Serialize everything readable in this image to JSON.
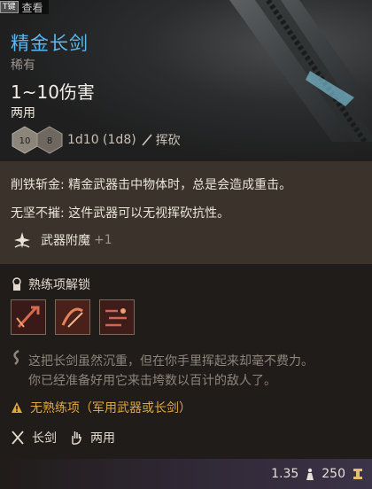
{
  "hint": {
    "key": "T键",
    "label": "查看"
  },
  "item": {
    "name": "精金长剑",
    "rarity": "稀有",
    "damage": "1~10伤害",
    "handedness": "两用",
    "dice": {
      "first": "10",
      "second": "8"
    },
    "dice_text": "1d10 (1d8)",
    "damage_type": "挥砍"
  },
  "properties": {
    "line1": "削铁斩金: 精金武器击中物体时，总是会造成重击。",
    "line2": "无坚不摧: 这件武器可以无视挥砍抗性。",
    "enchant_label": "武器附魔",
    "enchant_value": "+1"
  },
  "proficiency": {
    "label": "熟练项解锁",
    "skills": [
      "skill-1",
      "skill-2",
      "skill-3"
    ]
  },
  "flavor": {
    "line1": "这把长剑虽然沉重，但在你手里挥起来却毫不费力。",
    "line2": "你已经准备好用它来击垮数以百计的敌人了。"
  },
  "warning": "无熟练项（军用武器或长剑）",
  "tags": {
    "weapon": "长剑",
    "hands": "两用"
  },
  "footer": {
    "weight": "1.35",
    "value": "250"
  },
  "colors": {
    "name": "#5bb8ef",
    "warning": "#e0a640",
    "body_bg": "#201c19",
    "props_bg": "#3a322b"
  }
}
